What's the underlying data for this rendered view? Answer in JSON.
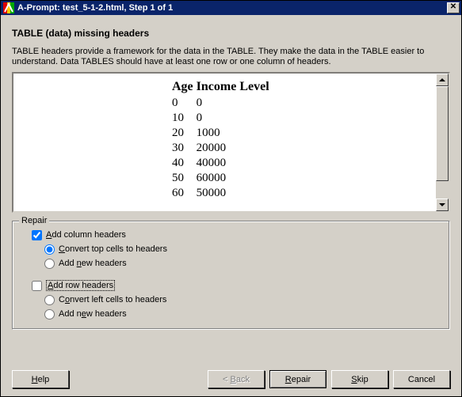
{
  "titlebar": {
    "title": "A-Prompt:  test_5-1-2.html, Step 1 of 1"
  },
  "heading": "TABLE (data) missing headers",
  "description": "TABLE headers provide a framework for the data in the TABLE. They make the data in the TABLE easier to understand. Data TABLES should have at least one row or one column of headers.",
  "preview": {
    "headers": [
      "Age",
      "Income Level"
    ],
    "rows": [
      [
        "0",
        "0"
      ],
      [
        "10",
        "0"
      ],
      [
        "20",
        "1000"
      ],
      [
        "30",
        "20000"
      ],
      [
        "40",
        "40000"
      ],
      [
        "50",
        "60000"
      ],
      [
        "60",
        "50000"
      ]
    ]
  },
  "repair": {
    "legend": "Repair",
    "add_col": {
      "label_pre": "",
      "u": "A",
      "label_post": "dd column headers",
      "checked": true
    },
    "col_convert": {
      "u": "C",
      "label_post": "onvert top cells to headers",
      "selected": true
    },
    "col_new": {
      "label_pre": "Add ",
      "u": "n",
      "label_post": "ew headers",
      "selected": false
    },
    "add_row": {
      "u": "A",
      "label_post": "dd row headers",
      "checked": false
    },
    "row_convert": {
      "label_pre": "C",
      "u": "o",
      "label_post": "nvert left cells to headers",
      "selected": false
    },
    "row_new": {
      "label_pre": "Add n",
      "u": "e",
      "label_post": "w headers",
      "selected": false
    }
  },
  "buttons": {
    "help": {
      "u": "H",
      "rest": "elp"
    },
    "back": {
      "lt": "< ",
      "u": "B",
      "rest": "ack"
    },
    "repair": {
      "u": "R",
      "rest": "epair"
    },
    "skip": {
      "u": "S",
      "rest": "kip"
    },
    "cancel": "Cancel"
  }
}
